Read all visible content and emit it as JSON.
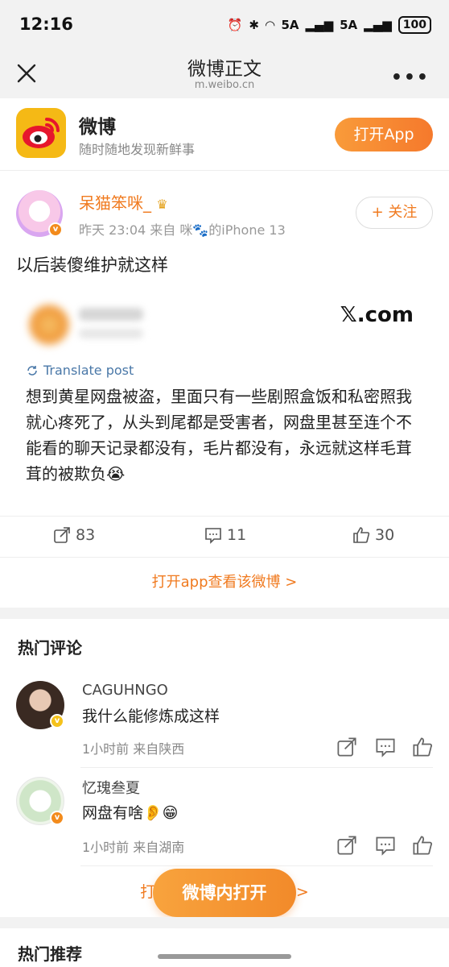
{
  "status_bar": {
    "time": "12:16",
    "network_1": "5A",
    "network_2": "5A",
    "battery": "100"
  },
  "nav": {
    "title": "微博正文",
    "domain": "m.weibo.cn"
  },
  "banner": {
    "app_name": "微博",
    "slogan": "随时随地发现新鲜事",
    "open_button": "打开App"
  },
  "post": {
    "author": "呆猫笨咪_",
    "meta": "昨天 23:04  来自 咪🐾的iPhone 13",
    "follow_label": "+ 关注",
    "text": "以后装傻维护就这样",
    "embed": {
      "site": "𝕏.com",
      "translate_label": "Translate post",
      "text": "想到黄星网盘被盗，里面只有一些剧照盒饭和私密照我就心疼死了，从头到尾都是受害者，网盘里甚至连个不能看的聊天记录都没有，毛片都没有，永远就这样毛茸茸的被欺负😭"
    },
    "actions": {
      "reposts": "83",
      "comments": "11",
      "likes": "30"
    },
    "open_in_app": "打开app查看该微博 >"
  },
  "hot_comments": {
    "title": "热门评论",
    "items": [
      {
        "name": "CAGUHNGO",
        "text": "我什么能修炼成这样",
        "meta": "1小时前  来自陕西"
      },
      {
        "name": "忆瑰叁夏",
        "text": "网盘有啥👂😁",
        "meta": "1小时前  来自湖南"
      }
    ],
    "more_link": "打开app查看更多评论 >"
  },
  "floating_button": "微博内打开",
  "recommend_title": "热门推荐",
  "colors": {
    "accent": "#f07a1f",
    "button_gradient_start": "#f99b3a",
    "button_gradient_end": "#f5792c"
  }
}
